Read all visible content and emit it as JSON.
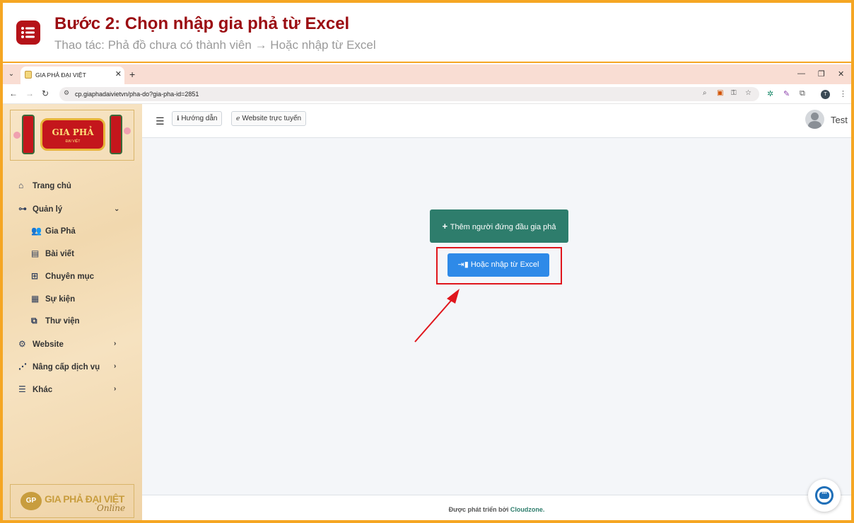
{
  "tutorial": {
    "title": "Bước 2: Chọn nhập gia phả từ Excel",
    "subtitle": "Thao tác: Phả đồ chưa có thành viên → Hoặc nhập từ Excel",
    "icon": "list-icon",
    "accent_color": "#9b0d12",
    "frame_color": "#f5a623"
  },
  "browser": {
    "tab_title": "GIA PHẢ ĐẠI VIỆT",
    "url": "cp.giaphadaivietvn/pha-do?gia-pha-id=2851",
    "profile_initial": "T"
  },
  "sidebar": {
    "logo_text": "GIA PHẢ",
    "logo_small": "ĐẠI VIỆT",
    "items": [
      {
        "label": "Trang chủ",
        "icon": "home-icon"
      },
      {
        "label": "Quản lý",
        "icon": "sitemap-icon"
      },
      {
        "label": "Gia Phả",
        "icon": "users-icon"
      },
      {
        "label": "Bài viết",
        "icon": "newspaper-icon"
      },
      {
        "label": "Chuyên mục",
        "icon": "grid-icon"
      },
      {
        "label": "Sự kiện",
        "icon": "calendar-icon"
      },
      {
        "label": "Thư viện",
        "icon": "images-icon"
      },
      {
        "label": "Website",
        "icon": "gear-icon"
      },
      {
        "label": "Nâng cấp dịch vụ",
        "icon": "chart-icon"
      },
      {
        "label": "Khác",
        "icon": "bars-icon"
      }
    ],
    "footer_text": "GIA PHẢ ĐẠI VIỆT",
    "footer_badge": "GP",
    "footer_online": "Online"
  },
  "topnav": {
    "guide_label": "Hướng dẫn",
    "website_label": "Website trực tuyến",
    "user_name": "Test"
  },
  "main": {
    "add_button": "Thêm người đứng đầu gia phả",
    "excel_button": "Hoặc nhập từ Excel",
    "highlight_color": "#e0161d"
  },
  "footer": {
    "text": "Được phát triển bởi ",
    "brand": "Cloudzone."
  }
}
